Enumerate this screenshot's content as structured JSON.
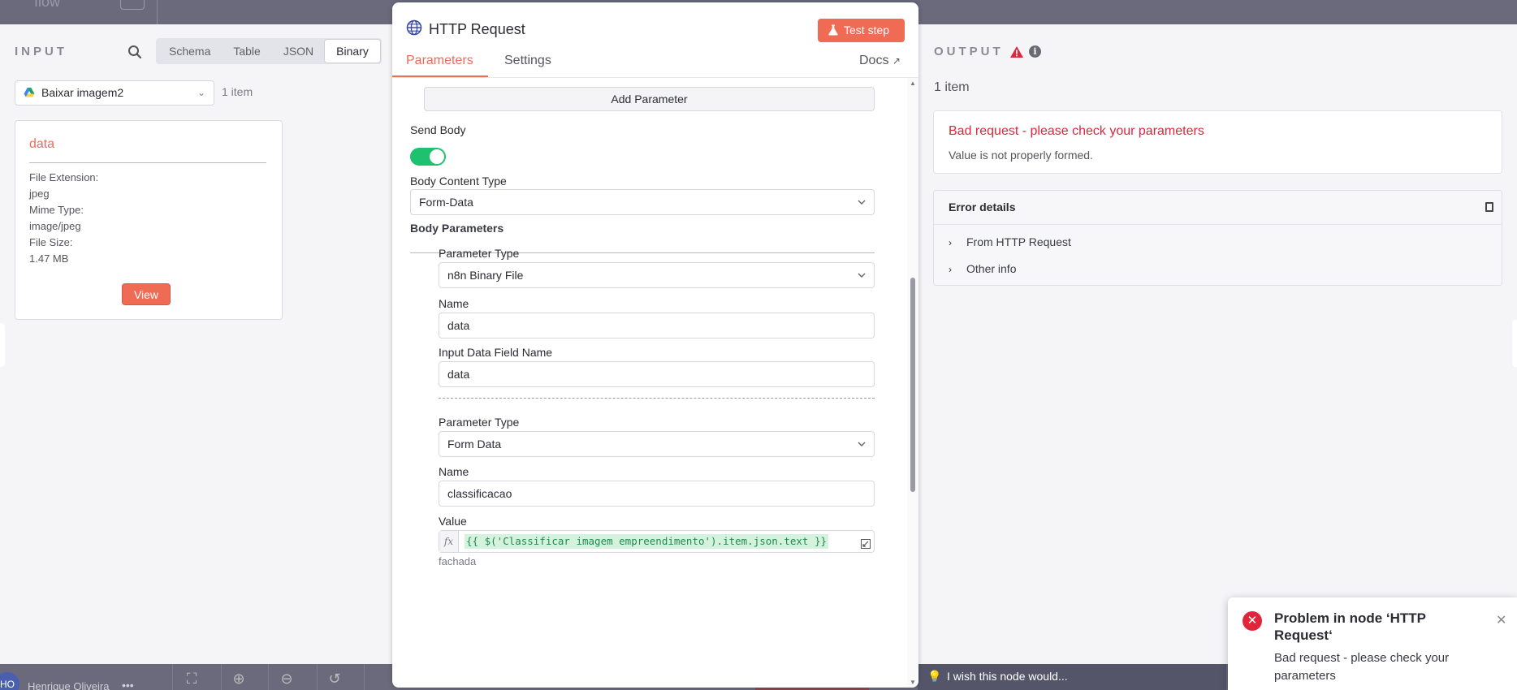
{
  "canvas": {
    "top_label": "flow",
    "user_initials": "HO",
    "user_name": "Henrique Oliveira",
    "user_menu": "•••",
    "wish_text": "I wish this node would..."
  },
  "input_panel": {
    "title": "INPUT",
    "view_tabs": [
      "Schema",
      "Table",
      "JSON",
      "Binary"
    ],
    "active_view": "Binary",
    "node_select": "Baixar imagem2",
    "item_count": "1 item",
    "binary": {
      "name": "data",
      "file_extension_label": "File Extension:",
      "file_extension": "jpeg",
      "mime_type_label": "Mime Type:",
      "mime_type": "image/jpeg",
      "file_size_label": "File Size:",
      "file_size": "1.47 MB",
      "view_button": "View"
    }
  },
  "node_modal": {
    "title": "HTTP Request",
    "test_button": "Test step",
    "tabs": [
      "Parameters",
      "Settings"
    ],
    "active_tab": "Parameters",
    "docs_link": "Docs",
    "add_parameter": "Add Parameter",
    "send_body_label": "Send Body",
    "send_body": true,
    "body_content_type_label": "Body Content Type",
    "body_content_type": "Form-Data",
    "body_parameters_label": "Body Parameters",
    "params": [
      {
        "type_label": "Parameter Type",
        "type": "n8n Binary File",
        "name_label": "Name",
        "name": "data",
        "field_label": "Input Data Field Name",
        "field": "data"
      },
      {
        "type_label": "Parameter Type",
        "type": "Form Data",
        "name_label": "Name",
        "name": "classificacao",
        "value_label": "Value",
        "value_expression": "{{ $('Classificar imagem empreendimento').item.json.text }}",
        "value_result": "fachada"
      }
    ]
  },
  "output_panel": {
    "title": "OUTPUT",
    "item_count": "1 item",
    "error_title": "Bad request - please check your parameters",
    "error_description": "Value is not properly formed.",
    "details_title": "Error details",
    "details_items": [
      "From HTTP Request",
      "Other info"
    ]
  },
  "toast": {
    "title": "Problem in node ‘HTTP Request‘",
    "message": "Bad request - please check your parameters"
  },
  "colors": {
    "accent": "#ea6e55",
    "error": "#e0263a",
    "toggle_on": "#1ec16e"
  }
}
